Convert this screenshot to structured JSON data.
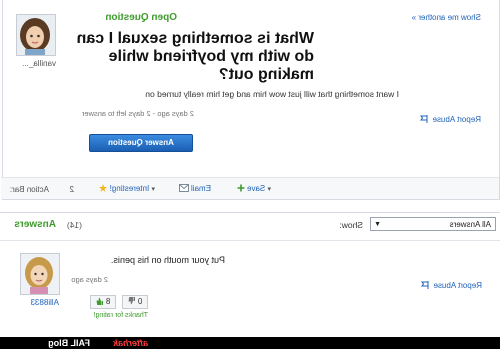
{
  "question": {
    "status": "Open Question",
    "show_another": "Show me another »",
    "title": "What is something sexual I can do with my boyfriend while making out?",
    "details": "I want something that will just wow him and get him really turned on",
    "meta": "2 days ago - 2 days left to answer",
    "report_abuse": "Report Abuse",
    "answer_button": "Answer Question",
    "asker_name": "vanilla_..."
  },
  "action_bar": {
    "label": "Action Bar:",
    "interesting_count": "2",
    "interesting_label": "Interesting!",
    "email_label": "Email",
    "save_label": "Save"
  },
  "answers": {
    "heading": "Answers",
    "count": "(14)",
    "show_label": "Show:",
    "filter_value": "All Answers",
    "items": [
      {
        "text": "Put your mouth on his penis.",
        "meta": "2 days ago",
        "report_abuse": "Report Abuse",
        "author": "Alli8833",
        "thumbs_up": "8",
        "thumbs_down": "0",
        "rating_thanks": "Thanks for rating!"
      }
    ]
  },
  "footer": {
    "brand": "FAIL Blog",
    "partner": "afterhak"
  },
  "colors": {
    "accent_green": "#3f9b2e",
    "link_blue": "#1f63b8",
    "button_blue": "#2a74cf"
  }
}
